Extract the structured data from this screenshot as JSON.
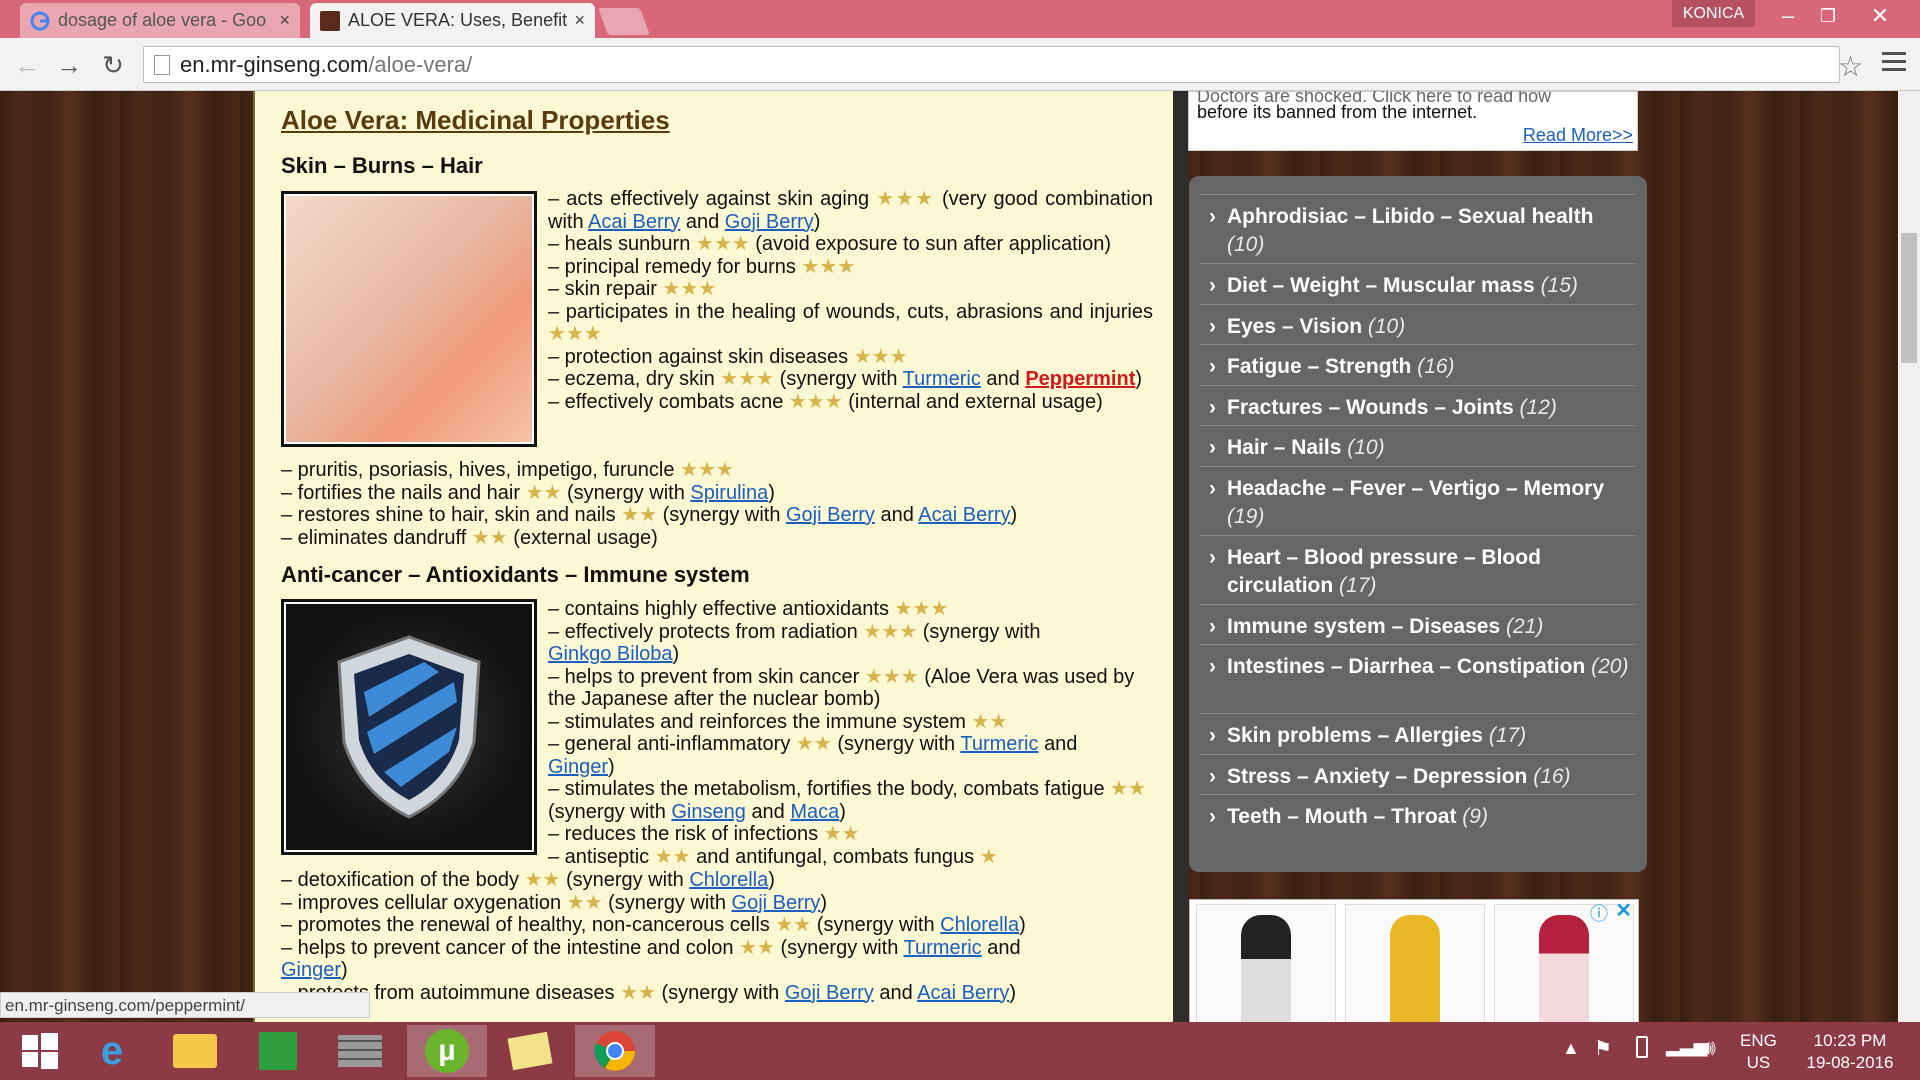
{
  "browser": {
    "tabs": [
      {
        "title": "dosage of aloe vera - Goo",
        "close": "×"
      },
      {
        "title": "ALOE VERA: Uses, Benefits",
        "close": "×"
      }
    ],
    "user": "KONICA",
    "url_host": "en.mr-ginseng.com",
    "url_path": "/aloe-vera/",
    "status_url": "en.mr-ginseng.com/peppermint/"
  },
  "page": {
    "heading": "Aloe Vera: Medicinal Properties",
    "section1_title": "Skin – Burns – Hair",
    "section2_title": "Anti-cancer – Antioxidants – Immune system",
    "stars3": "★★★",
    "stars2": "★★",
    "stars1": "★",
    "s1": {
      "l1a": "– acts effectively against skin aging",
      "l1b": "(very good combination with",
      "acai": "Acai Berry",
      "and": "and",
      "goji": "Goji Berry",
      "close": ")",
      "l2a": "– heals sunburn",
      "l2b": "(avoid exposure to sun after application)",
      "l3": "– principal remedy for burns",
      "l4": "– skin repair",
      "l5": "– participates in the healing of wounds, cuts, abrasions and injuries",
      "l6": "– protection against skin diseases",
      "l7a": "– eczema, dry skin",
      "l7b": "(synergy with",
      "turmeric": "Turmeric",
      "peppermint": "Peppermint",
      "l8a": "– effectively combats acne",
      "l8b": "(internal and external usage)",
      "l9": "– pruritis, psoriasis, hives, impetigo, furuncle",
      "l10a": "– fortifies the nails and hair",
      "l10b": "(synergy with",
      "spirulina": "Spirulina",
      "l11a": "– restores shine to hair, skin and nails",
      "l11b": "(synergy with",
      "l12a": "– eliminates dandruff",
      "l12b": "(external usage)"
    },
    "s2": {
      "l1": "– contains highly effective antioxidants",
      "l2a": "– effectively protects from radiation",
      "l2b": "(synergy with",
      "ginkgo": "Ginkgo Biloba",
      "l3a": "– helps to prevent from skin cancer",
      "l3b": "(Aloe Vera was used by the Japanese after the nuclear bomb)",
      "l4": "– stimulates and reinforces the immune system",
      "l5a": "– general anti-inflammatory",
      "l5b": "(synergy with",
      "turmeric": "Turmeric",
      "ginger": "Ginger",
      "l6a": "– stimulates the metabolism, fortifies the body, combats fatigue",
      "l6b": "(synergy with",
      "ginseng": "Ginseng",
      "maca": "Maca",
      "l7": "– reduces the risk of infections",
      "l8a": "– antiseptic",
      "l8b": "and antifungal, combats fungus",
      "l9a": "– detoxification of the body",
      "l9b": "(synergy with",
      "chlorella": "Chlorella",
      "l10a": "– improves cellular oxygenation",
      "l10b": "(synergy with",
      "goji": "Goji Berry",
      "l11a": "– promotes the renewal of healthy, non-cancerous cells",
      "l11b": "(synergy with",
      "l12a": "– helps to prevent cancer of the intestine and colon",
      "l12b": "(synergy with",
      "l13a": "– protects from autoimmune diseases",
      "l13b": "(synergy with",
      "acai": "Acai Berry",
      "and": "and",
      "close": ")"
    }
  },
  "ad_top": {
    "text1": "Doctors are shocked. Click here to read how",
    "text2": "before its banned from the internet.",
    "read_more": "Read More>>"
  },
  "categories": [
    {
      "label": "Aphrodisiac – Libido – Sexual health",
      "count": "(10)"
    },
    {
      "label": "Diet – Weight – Muscular mass",
      "count": "(15)"
    },
    {
      "label": "Eyes – Vision",
      "count": "(10)"
    },
    {
      "label": "Fatigue – Strength",
      "count": "(16)"
    },
    {
      "label": "Fractures – Wounds – Joints",
      "count": "(12)"
    },
    {
      "label": "Hair – Nails",
      "count": "(10)"
    },
    {
      "label": "Headache – Fever – Vertigo – Memory",
      "count": "(19)"
    },
    {
      "label": "Heart – Blood pressure – Blood circulation",
      "count": "(17)"
    },
    {
      "label": "Immune system – Diseases",
      "count": "(21)"
    },
    {
      "label": "Intestines – Diarrhea – Constipation",
      "count": "(20)"
    },
    {
      "label": "Skin problems – Allergies",
      "count": "(17)"
    },
    {
      "label": "Stress – Anxiety – Depression",
      "count": "(16)"
    },
    {
      "label": "Teeth – Mouth – Throat",
      "count": "(9)"
    }
  ],
  "taskbar": {
    "lang1": "ENG",
    "lang2": "US",
    "time": "10:23 PM",
    "date": "19-08-2016"
  }
}
